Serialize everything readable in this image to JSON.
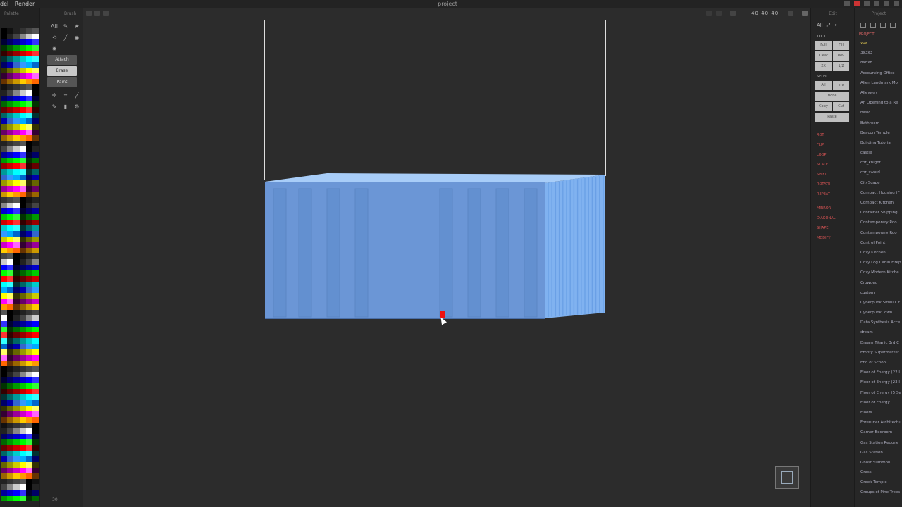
{
  "window": {
    "title": "project"
  },
  "menu": [
    "del",
    "Render"
  ],
  "panels": {
    "palette_label": "Palette",
    "brush_label": "Brush",
    "edit_label": "Edit",
    "project_label": "Project"
  },
  "brush": {
    "mode_all": "All",
    "buttons": [
      "Attach",
      "Erase",
      "Paint"
    ]
  },
  "viewport": {
    "dims": "40  40  40",
    "bottom_label": "30"
  },
  "edit": {
    "mode_all": "All",
    "tool_section": "TOOL",
    "tool_buttons": [
      [
        "Full",
        "Fill"
      ],
      [
        "Clear",
        "Rev"
      ],
      [
        "2X",
        "1/2"
      ]
    ],
    "select_section": "SELECT",
    "select_buttons": [
      [
        "All",
        "Inv"
      ]
    ],
    "select_none": "None",
    "select_copy": [
      [
        "Copy",
        "Cut"
      ]
    ],
    "select_paste": "Paste",
    "red_sections": [
      "ROT",
      "FLIP",
      "LOOP",
      "SCALE",
      "SHIFT",
      "ROTATE",
      "REPEAT",
      "MIRROR",
      "DIAGONAL",
      "SHAPE",
      "MODIFY"
    ]
  },
  "project": {
    "section": "PROJECT",
    "items": [
      "vox",
      "3x3x3",
      "8x8x8",
      "Accounting Office",
      "Alien Landmark Mo",
      "Alleyway",
      "An Opening to a Re",
      "basic",
      "Bathroom",
      "Beacon Temple",
      "Building Tutorial",
      "castle",
      "chr_knight",
      "chr_sword",
      "CityScape",
      "Compact Housing (F",
      "Compact Kitchen",
      "Container Shipping",
      "Contemporary Roo",
      "Contemporary Roo",
      "Control Point",
      "Cozy Kitchen",
      "Cozy Log Cabin Firep",
      "Cozy Modern Kitche",
      "Crowded",
      "custom",
      "Cyberpunk Small Cit",
      "Cyberpunk Town",
      "Data Synthesis Acce",
      "dream",
      "Dream Titanic 3rd C",
      "Empty Supermarket",
      "End of School",
      "Floor of Energy (22 l",
      "Floor of Energy (23 l",
      "Floor of Energy (5 Se",
      "Floor of Energy",
      "Floors",
      "Foreruner Architectu",
      "Gamer Bedroom",
      "Gas Station Redone",
      "Gas Station",
      "Ghost Summon",
      "Grass",
      "Greek Temple",
      "Groups of Pine Trees"
    ]
  },
  "colors": {
    "container_front": "#6b96d6",
    "container_side": "#7fb1f0",
    "container_top": "#a8cdf8",
    "selection": "#e11111",
    "accent_red": "#cc3333"
  }
}
